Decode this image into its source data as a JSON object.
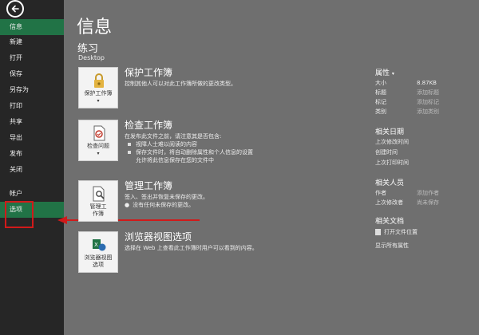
{
  "sidebar": {
    "items": [
      {
        "label": "信息",
        "active": true
      },
      {
        "label": "新建"
      },
      {
        "label": "打开"
      },
      {
        "label": "保存"
      },
      {
        "label": "另存为"
      },
      {
        "label": "打印"
      },
      {
        "label": "共享"
      },
      {
        "label": "导出"
      },
      {
        "label": "发布"
      },
      {
        "label": "关闭"
      },
      {
        "label": "帐户"
      },
      {
        "label": "选项",
        "active": true
      }
    ]
  },
  "page": {
    "title": "信息",
    "workbook_name": "练习",
    "workbook_path": "Desktop"
  },
  "sections": {
    "protect": {
      "button": "保护工作簿",
      "title": "保护工作簿",
      "desc": "控制其他人可以对此工作簿所做的更改类型。"
    },
    "inspect": {
      "button": "检查问题",
      "title": "检查工作簿",
      "desc": "在发布此文件之前，请注意其是否包含:",
      "bullets": [
        "视障人士难以阅读的内容",
        "保存文件时，将自动删除属性和个人信息的设置"
      ],
      "sub": "允许将此信息保存在您的文件中"
    },
    "manage": {
      "button_line1": "管理工",
      "button_line2": "作簿",
      "title": "管理工作簿",
      "desc": "签入、签出并恢复未保存的更改。",
      "bullet": "没有任何未保存的更改。"
    },
    "browser": {
      "button_line1": "浏览器视图",
      "button_line2": "选项",
      "title": "浏览器视图选项",
      "desc": "选择在 Web 上查看此工作簿时用户可以看到的内容。"
    }
  },
  "properties": {
    "heading": "属性",
    "rows": [
      {
        "key": "大小",
        "value": "8.87KB"
      },
      {
        "key": "标题",
        "value": "添加标题"
      },
      {
        "key": "标记",
        "value": "添加标记"
      },
      {
        "key": "类别",
        "value": "添加类别"
      }
    ],
    "dates_heading": "相关日期",
    "dates": [
      {
        "key": "上次修改时间"
      },
      {
        "key": "创建时间"
      },
      {
        "key": "上次打印时间"
      }
    ],
    "people_heading": "相关人员",
    "people": [
      {
        "key": "作者",
        "value": "添加作者"
      },
      {
        "key": "上次修改者",
        "value": "尚未保存"
      }
    ],
    "docs_heading": "相关文档",
    "open_location": "打开文件位置",
    "show_all": "显示所有属性"
  },
  "colors": {
    "accent": "#217346",
    "annotation": "#d11a1a"
  }
}
